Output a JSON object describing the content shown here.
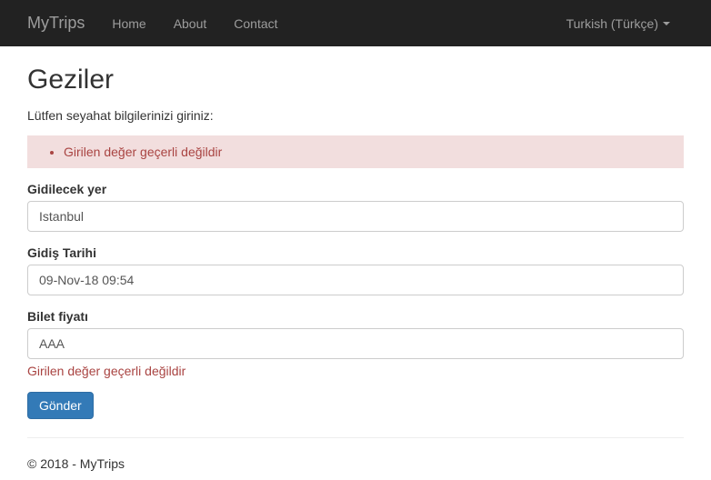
{
  "nav": {
    "brand": "MyTrips",
    "home": "Home",
    "about": "About",
    "contact": "Contact",
    "language": "Turkish (Türkçe)"
  },
  "page": {
    "title": "Geziler",
    "intro": "Lütfen seyahat bilgilerinizi giriniz:"
  },
  "errors": {
    "summary_item": "Girilen değer geçerli değildir"
  },
  "form": {
    "destination": {
      "label": "Gidilecek yer",
      "value": "Istanbul"
    },
    "date": {
      "label": "Gidiş Tarihi",
      "value": "09-Nov-18 09:54"
    },
    "price": {
      "label": "Bilet fiyatı",
      "value": "AAA",
      "error": "Girilen değer geçerli değildir"
    },
    "submit": "Gönder"
  },
  "footer": {
    "text": "© 2018 - MyTrips"
  }
}
